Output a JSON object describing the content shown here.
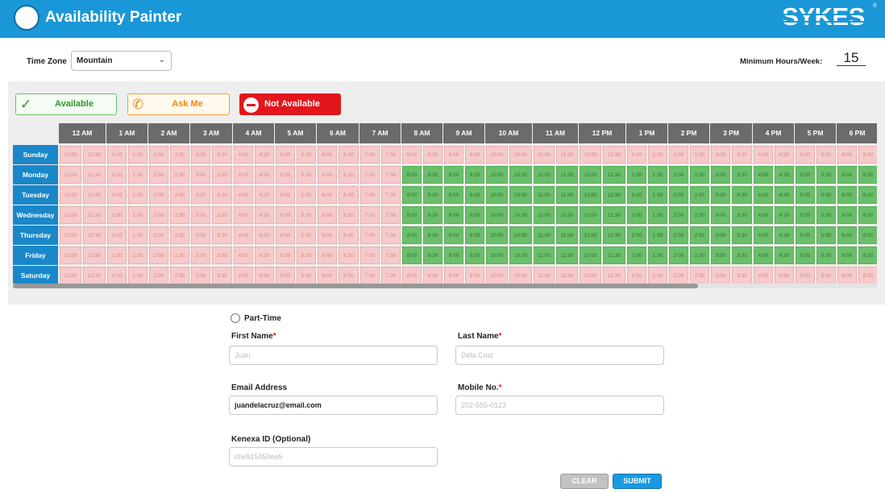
{
  "header": {
    "title": "Availability Painter",
    "brand": "SYKES",
    "brand_mark": "®"
  },
  "settings": {
    "time_zone_label": "Time Zone",
    "time_zone_value": "Mountain",
    "min_hours_label": "Minimum Hours/Week:",
    "min_hours_value": "15"
  },
  "legend": {
    "available": "Available",
    "ask_me": "Ask Me",
    "not_available": "Not Available",
    "colors": {
      "available": "#6abf6a",
      "ask_me": "#f08a00",
      "not_available": "#e4161b"
    }
  },
  "schedule": {
    "hours": [
      "12 AM",
      "1 AM",
      "2 AM",
      "3 AM",
      "4 AM",
      "5 AM",
      "6 AM",
      "7 AM",
      "8 AM",
      "9 AM",
      "10 AM",
      "11 AM",
      "12 PM",
      "1 PM",
      "2 PM",
      "3 PM",
      "4 PM",
      "5 PM",
      "6 PM"
    ],
    "slots": [
      "12:00",
      "12:30",
      "1:00",
      "1:30",
      "2:00",
      "2:30",
      "3:00",
      "3:30",
      "4:00",
      "4:30",
      "5:00",
      "5:30",
      "6:00",
      "6:30",
      "7:00",
      "7:30",
      "8:00",
      "8:30",
      "9:00",
      "9:30",
      "10:00",
      "10:30",
      "11:00",
      "11:30",
      "12:00",
      "12:30",
      "1:00",
      "1:30",
      "2:00",
      "2:30",
      "3:00",
      "3:30",
      "4:00",
      "4:30",
      "5:00",
      "5:30",
      "6:00",
      "6:30"
    ],
    "days": [
      {
        "name": "Sunday",
        "available_from_slot": null
      },
      {
        "name": "Monday",
        "available_from_slot": 16
      },
      {
        "name": "Tuesday",
        "available_from_slot": 16
      },
      {
        "name": "Wednesday",
        "available_from_slot": 16
      },
      {
        "name": "Thursday",
        "available_from_slot": 16
      },
      {
        "name": "Friday",
        "available_from_slot": 16
      },
      {
        "name": "Saturday",
        "available_from_slot": null
      }
    ]
  },
  "form": {
    "part_time_label": "Part-Time",
    "first_name_label": "First Name",
    "first_name_placeholder": "Juan",
    "last_name_label": "Last Name",
    "last_name_placeholder": "Dela Cruz",
    "email_label": "Email Address",
    "email_value": "juandelacruz@email.com",
    "mobile_label": "Mobile No.",
    "mobile_placeholder": "202-555-0123",
    "kenexa_label": "Kenexa ID (Optional)",
    "kenexa_placeholder": "c0e915450ee5",
    "required_mark": "*",
    "clear_label": "CLEAR",
    "submit_label": "SUBMIT"
  }
}
